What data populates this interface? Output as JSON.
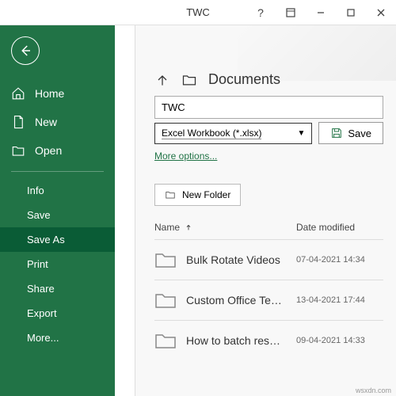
{
  "titlebar": {
    "title": "TWC",
    "help": "?"
  },
  "sidebar": {
    "home": "Home",
    "new": "New",
    "open": "Open",
    "info": "Info",
    "save": "Save",
    "saveas": "Save As",
    "print": "Print",
    "share": "Share",
    "export": "Export",
    "more": "More..."
  },
  "main": {
    "breadcrumb": "Documents",
    "filename": "TWC",
    "filetype": "Excel Workbook (*.xlsx)",
    "save_label": "Save",
    "more_options": "More options...",
    "new_folder": "New Folder",
    "col_name": "Name",
    "col_date": "Date modified",
    "files": [
      {
        "name": "Bulk Rotate Videos",
        "date": "07-04-2021 14:34"
      },
      {
        "name": "Custom Office Te…",
        "date": "13-04-2021 17:44"
      },
      {
        "name": "How to batch res…",
        "date": "09-04-2021 14:33"
      }
    ]
  },
  "watermark": "wsxdn.com"
}
